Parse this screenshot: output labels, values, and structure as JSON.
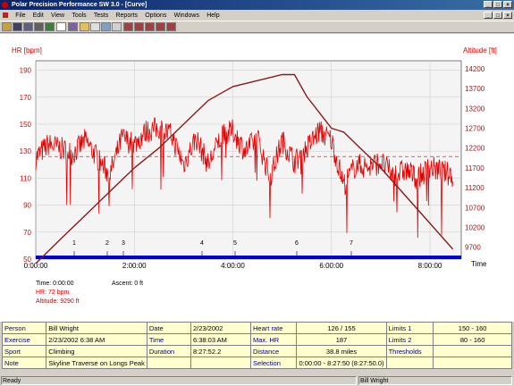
{
  "window": {
    "title": "Polar Precision Performance SW 3.0 - [Curve]"
  },
  "menu": [
    "File",
    "Edit",
    "View",
    "Tools",
    "Tests",
    "Reports",
    "Options",
    "Windows",
    "Help"
  ],
  "toolbar": {
    "icons": [
      "open-icon",
      "save-icon",
      "copy-icon",
      "print-icon",
      "globe-icon",
      "calendar-icon",
      "book-icon",
      "folder-icon",
      "chart-icon",
      "image-icon",
      "grid-icon",
      "bar-chart-icon",
      "bar-chart-icon",
      "bar-chart-icon",
      "bar-chart-icon",
      "bar-chart-icon"
    ]
  },
  "chart": {
    "left_axis_label": "HR [bpm]",
    "right_axis_label": "Altitude [ft]",
    "x_axis_label": "Time",
    "hr_ticks": [
      "190",
      "170",
      "150",
      "130",
      "110",
      "90",
      "70",
      "50"
    ],
    "alt_ticks": [
      "14200",
      "13700",
      "13200",
      "12700",
      "12200",
      "11700",
      "11200",
      "10700",
      "10200",
      "9700"
    ],
    "time_ticks": [
      "0:00:00",
      "2:00:00",
      "4:00:00",
      "6:00:00",
      "8:00:00"
    ],
    "laps": [
      "1",
      "2",
      "3",
      "4",
      "5",
      "6",
      "7"
    ],
    "cursor": {
      "time": "Time: 0:00:00",
      "hr": "HR: 72 bpm",
      "altitude": "Altitude: 9290 ft",
      "ascent": "Ascent: 0 ft"
    }
  },
  "chart_data": {
    "type": "line",
    "x_unit": "h:mm:ss",
    "xlim": [
      "0:00:00",
      "8:38:03"
    ],
    "hr_ylim": [
      50,
      197
    ],
    "alt_ylim": [
      9400,
      14400
    ],
    "threshold_hr": 126,
    "series": [
      {
        "name": "HR",
        "color": "#e00000",
        "x": [
          "0:00:00",
          "0:15:00",
          "0:30:00",
          "0:45:00",
          "1:00:00",
          "1:15:00",
          "1:30:00",
          "1:45:00",
          "2:00:00",
          "2:15:00",
          "2:30:00",
          "2:45:00",
          "3:00:00",
          "3:15:00",
          "3:30:00",
          "3:45:00",
          "4:00:00",
          "4:15:00",
          "4:30:00",
          "4:45:00",
          "5:00:00",
          "5:15:00",
          "5:30:00",
          "5:45:00",
          "6:00:00",
          "6:15:00",
          "6:30:00",
          "6:45:00",
          "7:00:00",
          "7:15:00",
          "7:30:00",
          "7:45:00",
          "8:00:00",
          "8:15:00",
          "8:27:52"
        ],
        "values": [
          125,
          135,
          132,
          128,
          138,
          125,
          112,
          140,
          135,
          145,
          147,
          142,
          120,
          140,
          120,
          140,
          145,
          130,
          140,
          110,
          138,
          122,
          132,
          145,
          138,
          105,
          120,
          118,
          122,
          112,
          116,
          110,
          118,
          115,
          112
        ]
      },
      {
        "name": "Altitude",
        "color": "#8b1a1a",
        "x": [
          "0:00:00",
          "0:30:00",
          "1:00:00",
          "1:30:00",
          "2:00:00",
          "2:30:00",
          "3:00:00",
          "3:30:00",
          "4:00:00",
          "4:30:00",
          "5:00:00",
          "5:15:00",
          "5:30:00",
          "6:00:00",
          "6:15:00",
          "6:30:00",
          "7:00:00",
          "7:30:00",
          "8:00:00",
          "8:27:52"
        ],
        "values": [
          9290,
          9900,
          10500,
          11100,
          11700,
          12200,
          12800,
          13400,
          13750,
          13900,
          14050,
          14050,
          13500,
          12700,
          12600,
          12300,
          11700,
          11000,
          10300,
          9650
        ]
      }
    ]
  },
  "info": {
    "rows": [
      [
        {
          "l": "Person"
        },
        {
          "v": "Bill Wright"
        },
        {
          "l": "Date"
        },
        {
          "v": "2/23/2002"
        },
        {
          "l": "Heart rate"
        },
        {
          "v": "126 / 155"
        },
        {
          "l": "Limits 1"
        },
        {
          "v": "150 - 160"
        }
      ],
      [
        {
          "l": "Exercise"
        },
        {
          "v": "2/23/2002 6:38 AM"
        },
        {
          "l": "Time"
        },
        {
          "v": "6:38:03 AM"
        },
        {
          "l": "Max. HR"
        },
        {
          "v": "187"
        },
        {
          "l": "Limits 2"
        },
        {
          "v": "80 - 160"
        }
      ],
      [
        {
          "l": "Sport"
        },
        {
          "v": "Climbing"
        },
        {
          "l": "Duration"
        },
        {
          "v": "8:27:52.2"
        },
        {
          "l": "Distance"
        },
        {
          "v": "38.8 miles"
        },
        {
          "l": "Thresholds"
        },
        {
          "v": ""
        }
      ],
      [
        {
          "l": "Note"
        },
        {
          "v": "Skyline Traverse on Longs Peak"
        },
        {
          "l": ""
        },
        {
          "v": ""
        },
        {
          "l": "Selection"
        },
        {
          "v": "0:00:00 - 8:27:50 (8:27:50.0)"
        },
        {
          "l": ""
        },
        {
          "v": ""
        }
      ]
    ]
  },
  "status": {
    "left": "Ready",
    "right": "Bill Wright"
  }
}
